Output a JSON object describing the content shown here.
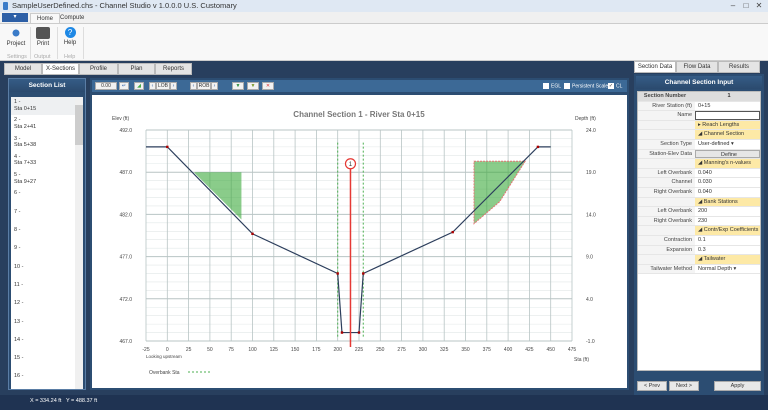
{
  "window": {
    "title": "SampleUserDefined.chs - Channel Studio v 1.0.0.0 U.S. Customary",
    "min": "–",
    "max": "□",
    "close": "✕"
  },
  "ribbon": {
    "tabs": [
      "Home",
      "Compute"
    ],
    "buttons": [
      {
        "label": "Project",
        "icon": "gear-icon"
      },
      {
        "label": "Print",
        "icon": "printer-icon"
      },
      {
        "label": "Help",
        "icon": "help-icon"
      }
    ],
    "groups": [
      "Settings",
      "Output",
      "Help"
    ]
  },
  "main_tabs": [
    "Model",
    "X-Sections",
    "Profile",
    "Plan",
    "Reports"
  ],
  "section_list": {
    "title": "Section List",
    "items": [
      [
        "1 -",
        "Sta 0+15"
      ],
      [
        "2 -",
        "Sta 2+41"
      ],
      [
        "3 -",
        "Sta 5+38"
      ],
      [
        "4 -",
        "Sta 7+33"
      ],
      [
        "5 -",
        "Sta 9+27"
      ],
      [
        "6 -",
        ""
      ],
      [
        "7 -",
        ""
      ],
      [
        "8 -",
        ""
      ],
      [
        "9 -",
        ""
      ],
      [
        "10 -",
        ""
      ],
      [
        "11 -",
        ""
      ],
      [
        "12 -",
        ""
      ],
      [
        "13 -",
        ""
      ],
      [
        "14 -",
        ""
      ],
      [
        "15 -",
        ""
      ],
      [
        "16 -",
        ""
      ]
    ]
  },
  "toolbar": {
    "value": "0.00",
    "lob": "LOB",
    "rob": "ROB",
    "egl": "EGL",
    "persistent_scale": "Persistent Scale",
    "cl": "CL",
    "cl_checked": true
  },
  "chart_data": {
    "type": "line",
    "title": "Channel Section 1 - River Sta 0+15",
    "xlabel": "Sta (ft)",
    "ylabel": "Elev (ft)",
    "y2label": "Depth (ft)",
    "xlim": [
      -25,
      475
    ],
    "ylim": [
      467,
      492
    ],
    "y2lim": [
      -1,
      24
    ],
    "xticks": [
      -25,
      0,
      25,
      50,
      75,
      100,
      125,
      150,
      175,
      200,
      225,
      250,
      275,
      300,
      325,
      350,
      375,
      400,
      425,
      450,
      475
    ],
    "yticks": [
      "492.0",
      "487.0",
      "482.0",
      "477.0",
      "472.0",
      "467.0"
    ],
    "y2ticks": [
      "24.0",
      "19.0",
      "14.0",
      "9.0",
      "4.0",
      "-1.0"
    ],
    "note": "Looking upstream",
    "legend": "Overbank Sta",
    "profile": [
      [
        -25,
        490
      ],
      [
        0,
        490
      ],
      [
        100,
        479.7
      ],
      [
        200,
        475
      ],
      [
        205,
        468
      ],
      [
        225,
        468
      ],
      [
        230,
        475
      ],
      [
        335,
        479.9
      ],
      [
        435,
        490
      ],
      [
        450,
        490
      ]
    ],
    "ineffective_left": [
      [
        32,
        487
      ],
      [
        87,
        487
      ],
      [
        87,
        481.4
      ],
      [
        32,
        486.9
      ]
    ],
    "ineffective_right": [
      [
        360,
        488.3
      ],
      [
        420,
        488.3
      ],
      [
        390,
        483.5
      ],
      [
        360,
        480.9
      ]
    ],
    "bank_stations": [
      200,
      230
    ],
    "centerline": 215,
    "centerline_label": "1"
  },
  "right_tabs": [
    "Section Data",
    "Flow Data",
    "Results"
  ],
  "section_input": {
    "title": "Channel Section Input",
    "rows": [
      {
        "l": "Section Number",
        "v": "1",
        "t": "hdr"
      },
      {
        "l": "River Station (ft)",
        "v": "0+15"
      },
      {
        "l": "Name",
        "v": ""
      },
      {
        "l": "",
        "v": "▸ Reach Lengths",
        "t": "cat"
      },
      {
        "l": "",
        "v": "◢ Channel Section",
        "t": "cat"
      },
      {
        "l": "Section Type",
        "v": "User-defined ▾"
      },
      {
        "l": "Station-Elev Data",
        "v": "Define"
      },
      {
        "l": "",
        "v": "◢ Manning's n-values",
        "t": "cat"
      },
      {
        "l": "Left Overbank",
        "v": "0.040"
      },
      {
        "l": "Channel",
        "v": "0.030"
      },
      {
        "l": "Right Overbank",
        "v": "0.040"
      },
      {
        "l": "",
        "v": "◢ Bank Stations",
        "t": "cat"
      },
      {
        "l": "Left Overbank",
        "v": "200"
      },
      {
        "l": "Right Overbank",
        "v": "230"
      },
      {
        "l": "",
        "v": "◢ Contr/Exp Coefficients",
        "t": "cat"
      },
      {
        "l": "Contraction",
        "v": "0.1"
      },
      {
        "l": "Expansion",
        "v": "0.3"
      },
      {
        "l": "",
        "v": "◢ Tailwater",
        "t": "cat"
      },
      {
        "l": "Tailwater Method",
        "v": "Normal Depth ▾"
      }
    ],
    "prev": "< Prev",
    "next": "Next >",
    "apply": "Apply"
  },
  "status": {
    "x": "X = 334.24 ft",
    "y": "Y = 488.37 ft"
  }
}
